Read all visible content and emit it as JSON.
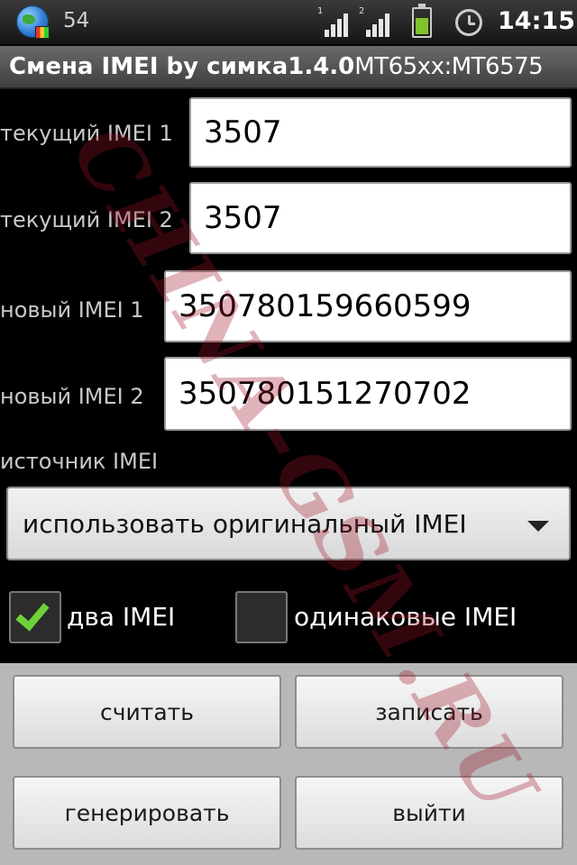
{
  "status_bar": {
    "notification_count": "54",
    "signal1_label": "1",
    "signal2_label": "2",
    "battery_level": 0.6,
    "time": "14:15",
    "icons": [
      "globe-app-icon",
      "signal-sim1-icon",
      "signal-sim2-icon",
      "battery-icon",
      "alarm-clock-icon"
    ]
  },
  "app": {
    "title_main": "Смена IMEI by симка1.4.0",
    "title_suffix": "MT65xx:MT6575"
  },
  "form": {
    "current_imei1": {
      "label": "текущий IMEI 1",
      "value": "3507"
    },
    "current_imei2": {
      "label": "текущий IMEI 2",
      "value": "3507"
    },
    "new_imei1": {
      "label": "новый IMEI 1",
      "value": "350780159660599"
    },
    "new_imei2": {
      "label": "новый IMEI 2",
      "value": "350780151270702"
    },
    "source_label": "источник IMEI",
    "source_selected": "использовать оригинальный IMEI"
  },
  "checkboxes": {
    "two_imei": {
      "label": "два IMEI",
      "checked": true
    },
    "same_imei": {
      "label": "одинаковые IMEI",
      "checked": false
    }
  },
  "buttons": {
    "read": "считать",
    "write": "записать",
    "generate": "генерировать",
    "exit": "выйти"
  },
  "watermark": "CHINA-GSM.RU",
  "colors": {
    "checkmark": "#6fd13a",
    "battery": "#7fc42a",
    "watermark": "#a01428"
  }
}
